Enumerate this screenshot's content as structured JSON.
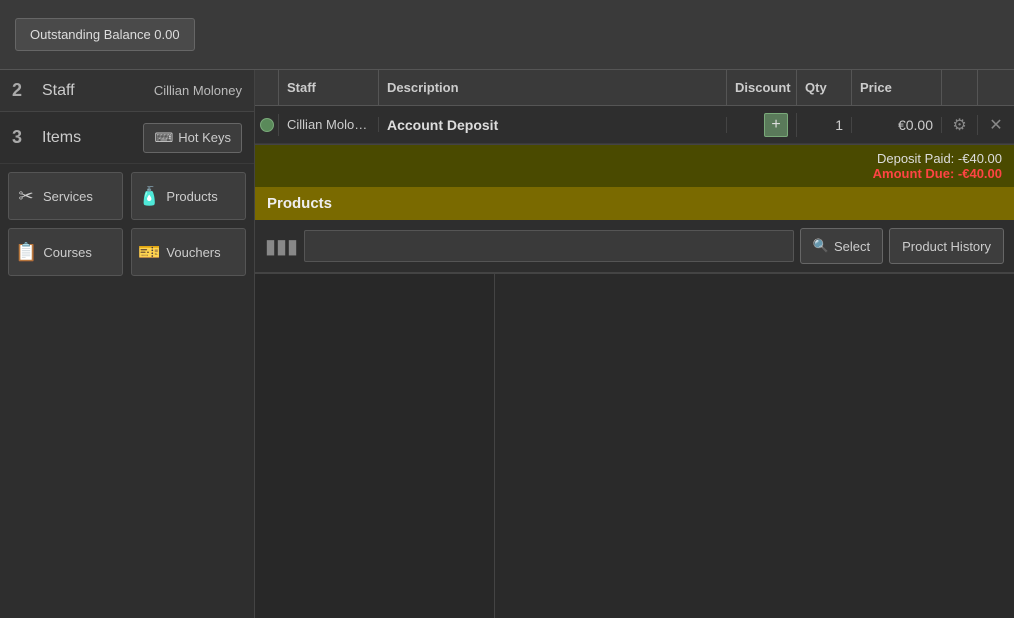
{
  "topbar": {
    "outstanding_balance_label": "Outstanding Balance 0.00"
  },
  "sidebar": {
    "section2_number": "2",
    "section2_label": "Staff",
    "staff_name": "Cillian Moloney",
    "section3_number": "3",
    "section3_label": "Items",
    "hot_keys_label": "Hot Keys",
    "services_label": "Services",
    "products_label": "Products",
    "courses_label": "Courses",
    "vouchers_label": "Vouchers"
  },
  "table": {
    "col_staff": "Staff",
    "col_description": "Description",
    "col_discount": "Discount",
    "col_qty": "Qty",
    "col_price": "Price",
    "rows": [
      {
        "staff": "Cillian Molon...",
        "description": "Account Deposit",
        "discount": "+",
        "qty": "1",
        "price": "€0.00"
      }
    ]
  },
  "summary": {
    "deposit_paid": "Deposit Paid: -€40.00",
    "amount_due_label": "Amount Due:",
    "amount_due_value": "-€40.00"
  },
  "products": {
    "header": "Products",
    "barcode_placeholder": "",
    "select_label": "Select",
    "history_label": "Product History"
  },
  "icons": {
    "barcode": "▮▮▮",
    "search": "🔍",
    "hot_keys": "⌨",
    "services": "✂",
    "products": "🧴",
    "courses": "📋",
    "vouchers": "🎫",
    "gear": "⚙",
    "close": "✕",
    "circle": "●",
    "plus": "+"
  }
}
